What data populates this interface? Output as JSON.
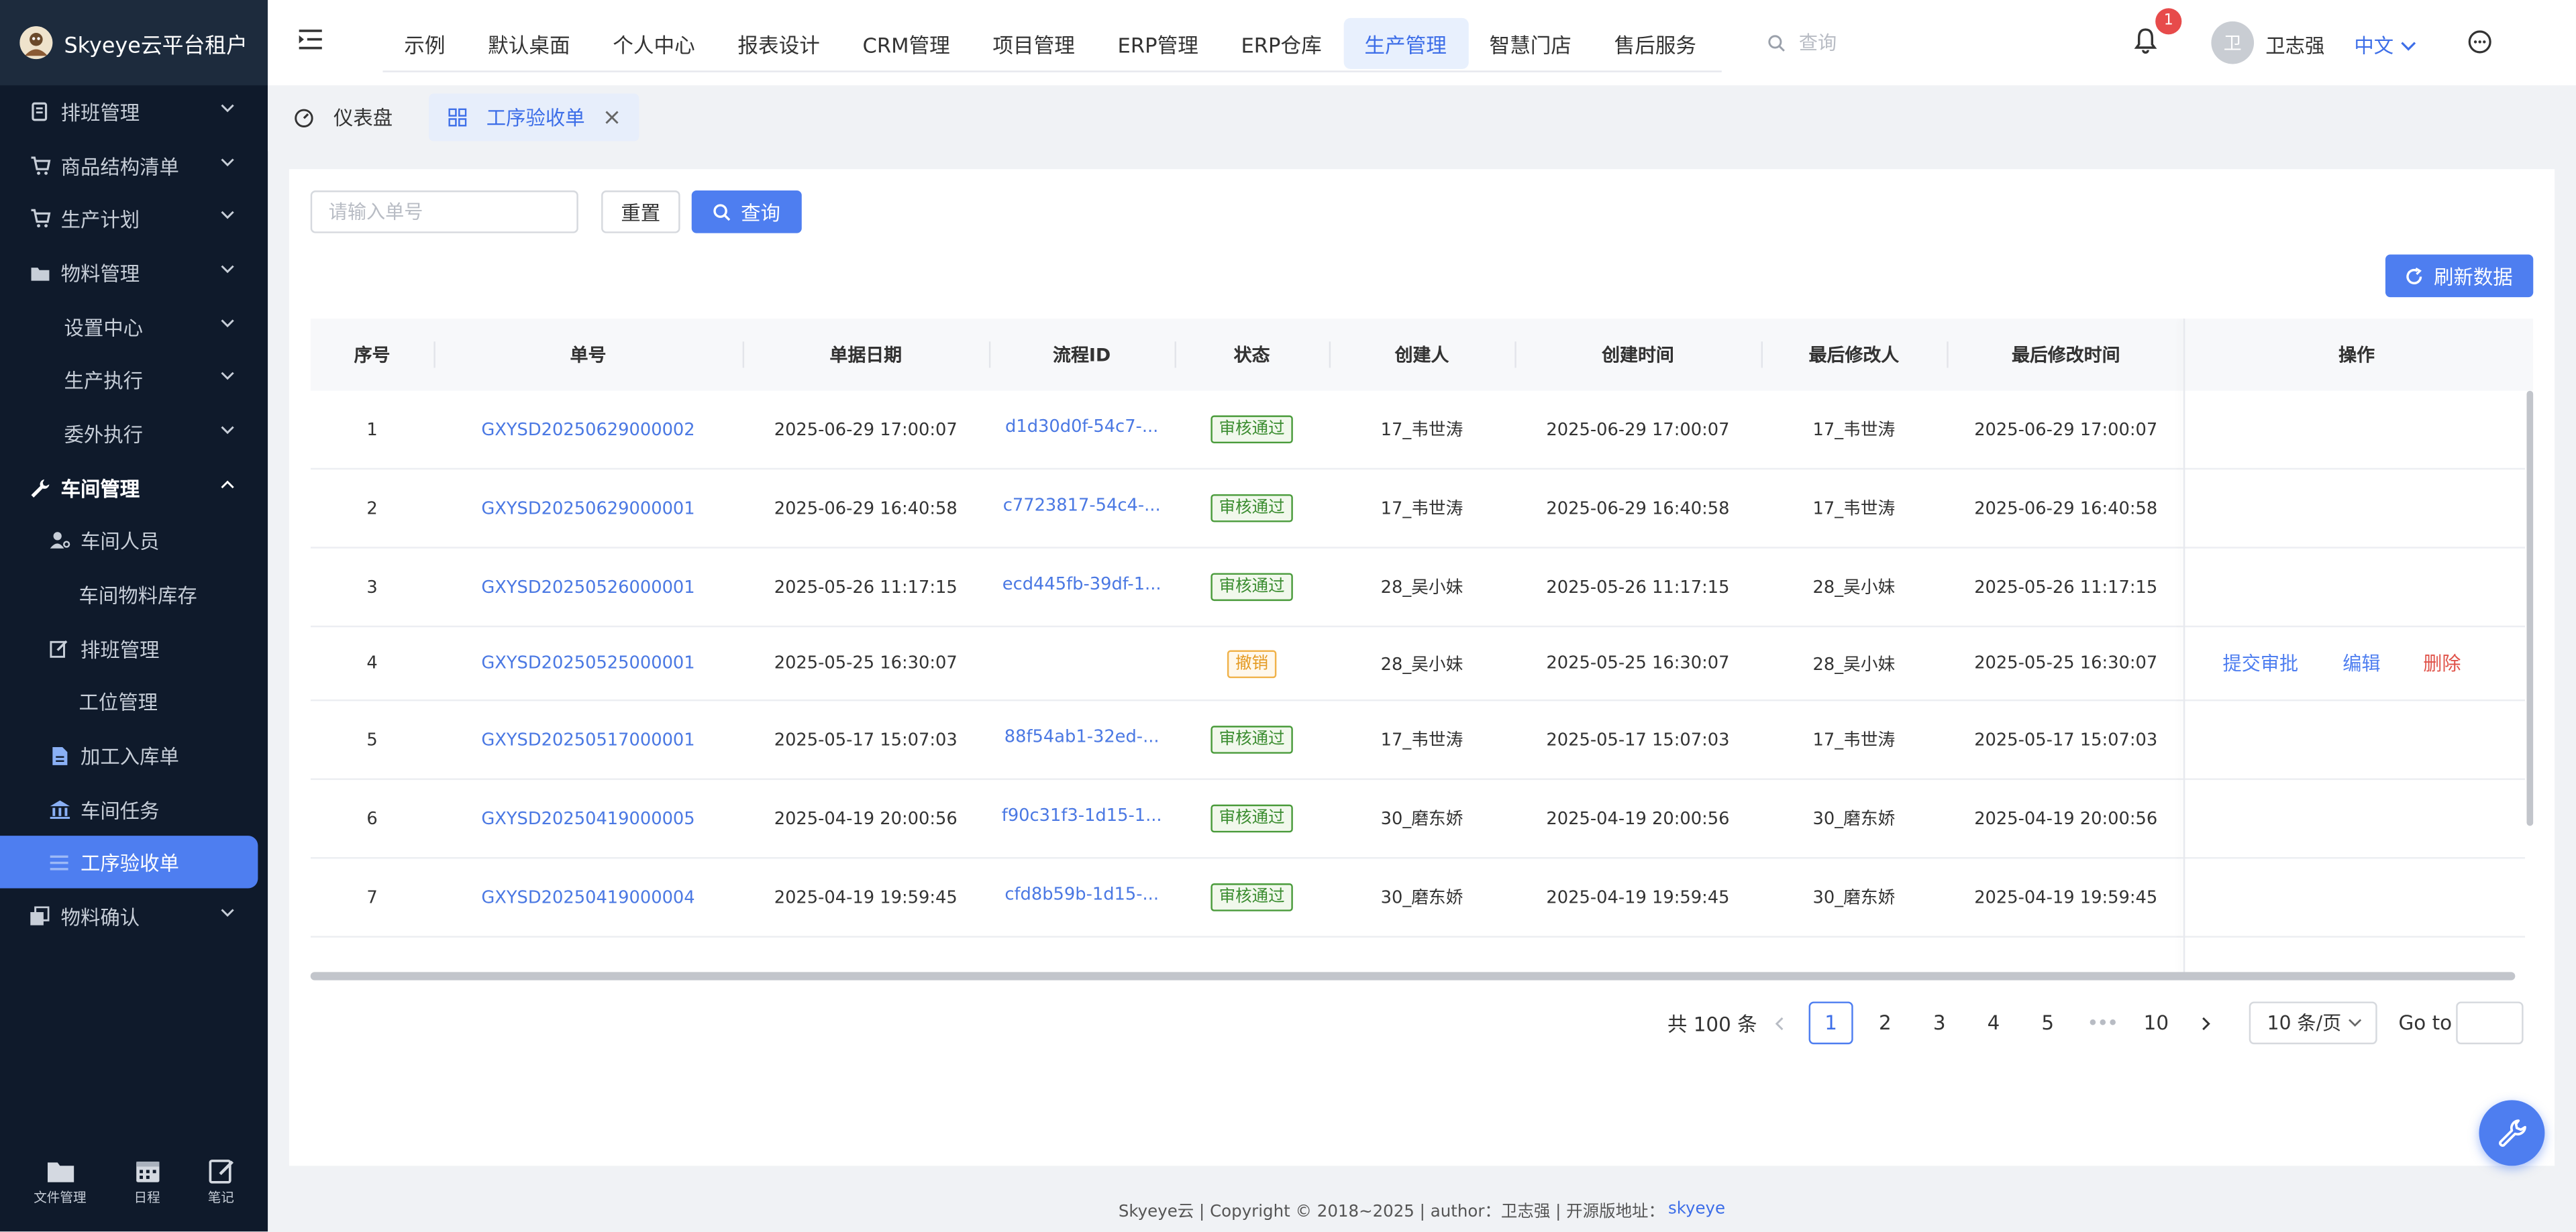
{
  "brand": {
    "title": "Skyeye云平台租户"
  },
  "sidebar": {
    "items": [
      {
        "label": "排班管理",
        "icon": "clipboard-icon"
      },
      {
        "label": "商品结构清单",
        "icon": "cart-icon"
      },
      {
        "label": "生产计划",
        "icon": "cart-icon"
      },
      {
        "label": "物料管理",
        "icon": "folder-icon"
      },
      {
        "label": "设置中心"
      },
      {
        "label": "生产执行"
      },
      {
        "label": "委外执行"
      },
      {
        "label": "车间管理",
        "icon": "wrench-icon"
      },
      {
        "label": "车间人员",
        "icon": "user-cog-icon"
      },
      {
        "label": "车间物料库存"
      },
      {
        "label": "排班管理",
        "icon": "edit-icon"
      },
      {
        "label": "工位管理"
      },
      {
        "label": "加工入库单",
        "icon": "doc-icon"
      },
      {
        "label": "车间任务",
        "icon": "bank-icon"
      },
      {
        "label": "工序验收单",
        "icon": "list-icon"
      },
      {
        "label": "物料确认",
        "icon": "copy-icon"
      }
    ],
    "footer": [
      {
        "label": "文件管理",
        "icon": "folder-icon"
      },
      {
        "label": "日程",
        "icon": "calendar-icon"
      },
      {
        "label": "笔记",
        "icon": "note-icon"
      }
    ]
  },
  "topnav": {
    "items": [
      "示例",
      "默认桌面",
      "个人中心",
      "报表设计",
      "CRM管理",
      "项目管理",
      "ERP管理",
      "ERP仓库",
      "生产管理",
      "智慧门店",
      "售后服务"
    ],
    "active": "生产管理",
    "search_placeholder": "查询",
    "notification_count": "1",
    "avatar_text": "卫",
    "username": "卫志强",
    "language": "中文"
  },
  "tabs": {
    "dashboard": "仪表盘",
    "current": "工序验收单"
  },
  "toolbar": {
    "search_placeholder": "请输入单号",
    "reset_label": "重置",
    "query_label": "查询",
    "refresh_label": "刷新数据"
  },
  "table": {
    "columns": [
      "序号",
      "单号",
      "单据日期",
      "流程ID",
      "状态",
      "创建人",
      "创建时间",
      "最后修改人",
      "最后修改时间",
      "操作"
    ],
    "rows": [
      {
        "no": "1",
        "code": "GXYSD20250629000002",
        "date": "2025-06-29 17:00:07",
        "flow": "d1d30d0f-54c7-...",
        "status": "审核通过",
        "creator": "17_韦世涛",
        "created": "2025-06-29 17:00:07",
        "modifier": "17_韦世涛",
        "modified": "2025-06-29 17:00:07"
      },
      {
        "no": "2",
        "code": "GXYSD20250629000001",
        "date": "2025-06-29 16:40:58",
        "flow": "c7723817-54c4-...",
        "status": "审核通过",
        "creator": "17_韦世涛",
        "created": "2025-06-29 16:40:58",
        "modifier": "17_韦世涛",
        "modified": "2025-06-29 16:40:58"
      },
      {
        "no": "3",
        "code": "GXYSD20250526000001",
        "date": "2025-05-26 11:17:15",
        "flow": "ecd445fb-39df-1...",
        "status": "审核通过",
        "creator": "28_吴小妹",
        "created": "2025-05-26 11:17:15",
        "modifier": "28_吴小妹",
        "modified": "2025-05-26 11:17:15"
      },
      {
        "no": "4",
        "code": "GXYSD20250525000001",
        "date": "2025-05-25 16:30:07",
        "flow": "",
        "status": "撤销",
        "creator": "28_吴小妹",
        "created": "2025-05-25 16:30:07",
        "modifier": "28_吴小妹",
        "modified": "2025-05-25 16:30:07",
        "actions": [
          "提交审批",
          "编辑",
          "删除"
        ]
      },
      {
        "no": "5",
        "code": "GXYSD20250517000001",
        "date": "2025-05-17 15:07:03",
        "flow": "88f54ab1-32ed-...",
        "status": "审核通过",
        "creator": "17_韦世涛",
        "created": "2025-05-17 15:07:03",
        "modifier": "17_韦世涛",
        "modified": "2025-05-17 15:07:03"
      },
      {
        "no": "6",
        "code": "GXYSD20250419000005",
        "date": "2025-04-19 20:00:56",
        "flow": "f90c31f3-1d15-1...",
        "status": "审核通过",
        "creator": "30_磨东娇",
        "created": "2025-04-19 20:00:56",
        "modifier": "30_磨东娇",
        "modified": "2025-04-19 20:00:56"
      },
      {
        "no": "7",
        "code": "GXYSD20250419000004",
        "date": "2025-04-19 19:59:45",
        "flow": "cfd8b59b-1d15-...",
        "status": "审核通过",
        "creator": "30_磨东娇",
        "created": "2025-04-19 19:59:45",
        "modifier": "30_磨东娇",
        "modified": "2025-04-19 19:59:45"
      }
    ]
  },
  "colors": {
    "accent": "#4e7ef0",
    "sidebar_bg": "#0f1a2b",
    "success": "#3a8c2f",
    "warning": "#e49a22",
    "danger": "#e0534a"
  },
  "pagination": {
    "total": "共 100 条",
    "pages": [
      "1",
      "2",
      "3",
      "4",
      "5",
      "10"
    ],
    "current": "1",
    "ellipsis": "•••",
    "page_size": "10 条/页",
    "goto_label": "Go to"
  },
  "footer": {
    "text": "Skyeye云 | Copyright © 2018~2025 | author：卫志强 | 开源版地址：",
    "link": "skyeye"
  }
}
